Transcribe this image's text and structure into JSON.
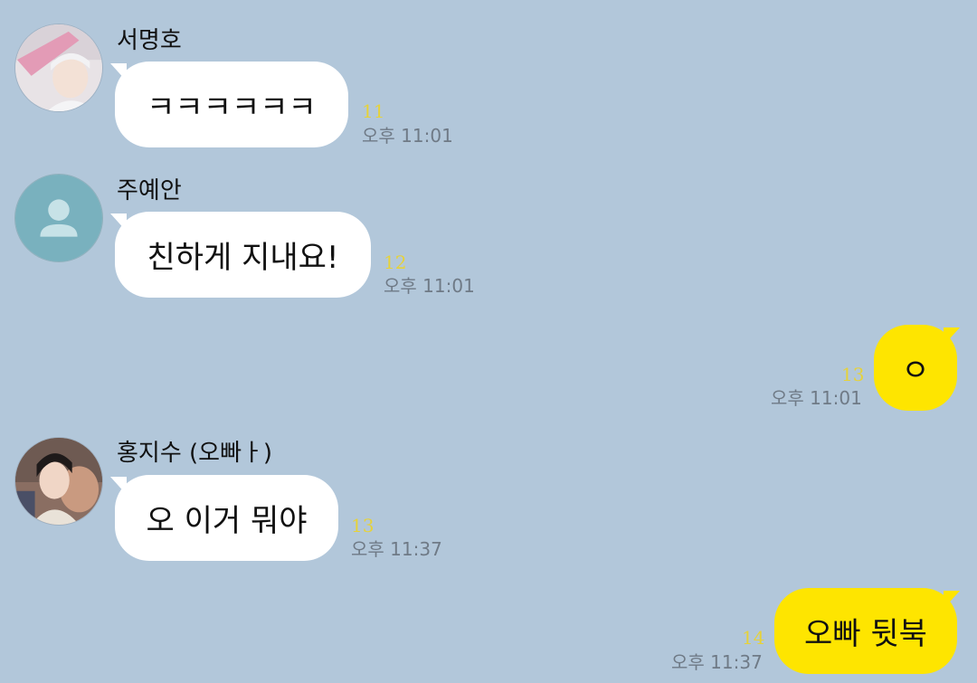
{
  "messages": [
    {
      "sender": "서명호",
      "text": "ㅋㅋㅋㅋㅋㅋ",
      "unread": "11",
      "time": "오후 11:01",
      "direction": "incoming",
      "avatar": "profile-photo"
    },
    {
      "sender": "주예안",
      "text": "친하게 지내요!",
      "unread": "12",
      "time": "오후 11:01",
      "direction": "incoming",
      "avatar": "default-person-icon"
    },
    {
      "text": "ㅇ",
      "unread": "13",
      "time": "오후 11:01",
      "direction": "outgoing"
    },
    {
      "sender": "홍지수 (오빠ㅏ)",
      "text": "오 이거 뭐야",
      "unread": "13",
      "time": "오후 11:37",
      "direction": "incoming",
      "avatar": "profile-photo"
    },
    {
      "text": "오빠 뒷북",
      "unread": "14",
      "time": "오후 11:37",
      "direction": "outgoing"
    }
  ],
  "colors": {
    "background": "#b2c7da",
    "incoming_bubble": "#ffffff",
    "outgoing_bubble": "#fee500",
    "unread_count": "#e6d23a",
    "timestamp": "#6f7a86",
    "default_avatar": "#79b1be"
  }
}
